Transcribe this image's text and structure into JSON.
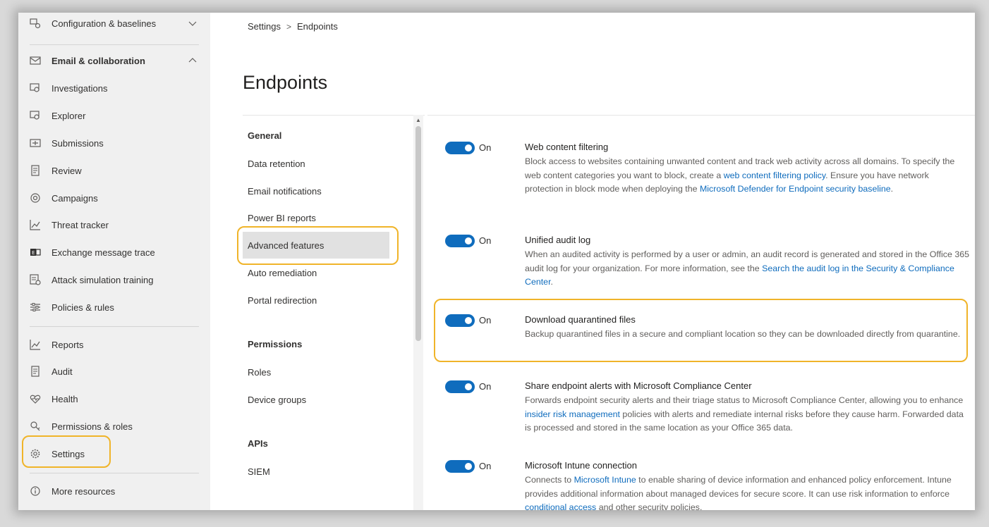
{
  "nav": {
    "items": [
      {
        "label": "Configuration & baselines",
        "icon": "configuration-icon",
        "top": 0
      },
      {
        "label": "Email & collaboration",
        "icon": "mail-icon"
      },
      {
        "label": "Investigations",
        "icon": "investigations-icon"
      },
      {
        "label": "Explorer",
        "icon": "explorer-icon"
      },
      {
        "label": "Submissions",
        "icon": "submissions-icon"
      },
      {
        "label": "Review",
        "icon": "review-icon"
      },
      {
        "label": "Campaigns",
        "icon": "campaigns-icon"
      },
      {
        "label": "Threat tracker",
        "icon": "threat-tracker-icon"
      },
      {
        "label": "Exchange message trace",
        "icon": "exchange-icon"
      },
      {
        "label": "Attack simulation training",
        "icon": "attack-simulation-icon"
      },
      {
        "label": "Policies & rules",
        "icon": "policies-icon"
      },
      {
        "label": "Reports",
        "icon": "reports-icon"
      },
      {
        "label": "Audit",
        "icon": "audit-icon"
      },
      {
        "label": "Health",
        "icon": "health-icon"
      },
      {
        "label": "Permissions & roles",
        "icon": "permissions-icon"
      },
      {
        "label": "Settings",
        "icon": "gear-icon"
      },
      {
        "label": "More resources",
        "icon": "info-icon"
      }
    ]
  },
  "breadcrumb": {
    "root": "Settings",
    "separator": ">",
    "current": "Endpoints"
  },
  "page_title": "Endpoints",
  "settings_nav": {
    "general_header": "General",
    "general_items": [
      "Data retention",
      "Email notifications",
      "Power BI reports",
      "Advanced features",
      "Auto remediation",
      "Portal redirection"
    ],
    "permissions_header": "Permissions",
    "permissions_items": [
      "Roles",
      "Device groups"
    ],
    "apis_header": "APIs",
    "apis_items": [
      "SIEM"
    ]
  },
  "features": [
    {
      "title": "Web content filtering",
      "state": "On",
      "desc_1": "Block access to websites containing unwanted content and track web activity across all domains. To specify the web content categories you want to block, create a ",
      "link_1": "web content filtering policy",
      "desc_2": ". Ensure you have network protection in block mode when deploying the ",
      "link_2": "Microsoft Defender for Endpoint security baseline",
      "desc_3": "."
    },
    {
      "title": "Unified audit log",
      "state": "On",
      "desc_1": "When an audited activity is performed by a user or admin, an audit record is generated and stored in the Office 365 audit log for your organization. For more information, see the ",
      "link_1": "Search the audit log in the Security & Compliance Center",
      "desc_2": "."
    },
    {
      "title": "Download quarantined files",
      "state": "On",
      "desc_1": "Backup quarantined files in a secure and compliant location so they can be downloaded directly from quarantine."
    },
    {
      "title": "Share endpoint alerts with Microsoft Compliance Center",
      "state": "On",
      "desc_1": "Forwards endpoint security alerts and their triage status to Microsoft Compliance Center, allowing you to enhance ",
      "link_1": "insider risk management",
      "desc_2": " policies with alerts and remediate internal risks before they cause harm. Forwarded data is processed and stored in the same location as your Office 365 data."
    },
    {
      "title": "Microsoft Intune connection",
      "state": "On",
      "desc_1": "Connects to ",
      "link_1": "Microsoft Intune",
      "desc_2": " to enable sharing of device information and enhanced policy enforcement. Intune provides additional information about managed devices for secure score. It can use risk information to enforce ",
      "link_2": "conditional access",
      "desc_3": " and other security policies."
    }
  ],
  "colors": {
    "accent": "#0f6cbd",
    "highlight": "#f0b429",
    "nav_bg": "#f0f0f0"
  }
}
